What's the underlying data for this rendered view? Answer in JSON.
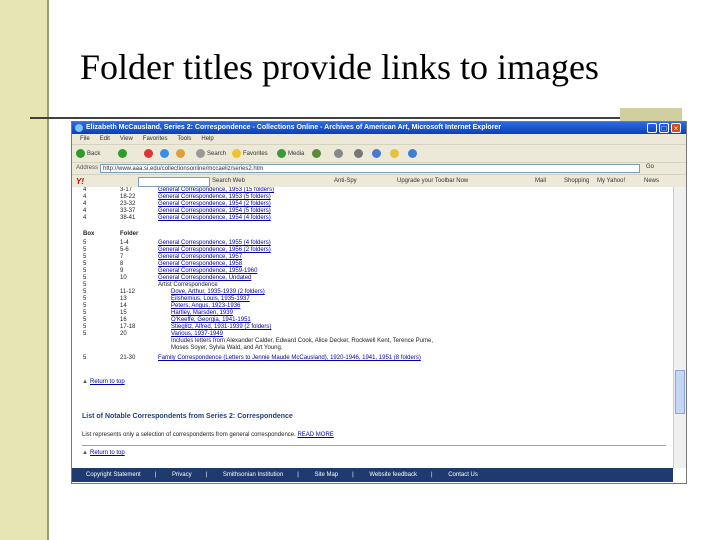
{
  "slide": {
    "title": "Folder titles provide links to images"
  },
  "browser": {
    "window_title": "Elizabeth McCausland, Series 2: Correspondence - Collections Online - Archives of American Art, Microsoft Internet Explorer",
    "menu": [
      "File",
      "Edit",
      "View",
      "Favorites",
      "Tools",
      "Help"
    ],
    "toolbar": {
      "back": "Back",
      "search": "Search",
      "favorites": "Favorites",
      "media": "Media"
    },
    "address_label": "Address",
    "address_value": "http://www.aaa.si.edu/collectionsonline/mccaeliz/series2.htm",
    "go_label": "Go",
    "yahoo": {
      "logo": "Y!",
      "search_web": "Search Web",
      "anti_spy": "Anti-Spy",
      "upgrade": "Upgrade your Toolbar Now",
      "mail": "Mail",
      "shopping": "Shopping",
      "my_yahoo": "My Yahoo!",
      "news": "News"
    }
  },
  "content": {
    "rows_top": [
      {
        "box": "4",
        "folder": "3-17",
        "title": "General Correspondence, 1953 (15 folders)"
      },
      {
        "box": "4",
        "folder": "18-22",
        "title": "General Correspondence, 1953 (5 folders)"
      },
      {
        "box": "4",
        "folder": "23-32",
        "title": "General Correspondence, 1954 (2 folders)"
      },
      {
        "box": "4",
        "folder": "33-37",
        "title": "General Correspondence, 1954 (5 folders)"
      },
      {
        "box": "4",
        "folder": "38-41",
        "title": "General Correspondence, 1954 (4 folders)"
      }
    ],
    "header": {
      "box": "Box",
      "folder": "Folder"
    },
    "rows_bottom": [
      {
        "box": "5",
        "folder": "1-4",
        "title": "General Correspondence, 1955 (4 folders)",
        "style": "link"
      },
      {
        "box": "5",
        "folder": "5-6",
        "title": "General Correspondence, 1956 (2 folders)",
        "style": "link"
      },
      {
        "box": "5",
        "folder": "7",
        "title": "General Correspondence, 1957",
        "style": "link"
      },
      {
        "box": "5",
        "folder": "8",
        "title": "General Correspondence, 1958",
        "style": "link"
      },
      {
        "box": "5",
        "folder": "9",
        "title": "General Correspondence, 1959-1960",
        "style": "link"
      },
      {
        "box": "5",
        "folder": "10",
        "title": "General Correspondence, Undated",
        "style": "link"
      },
      {
        "box": "5",
        "folder": "",
        "title": "Artist Correspondence",
        "style": "plain"
      },
      {
        "box": "5",
        "folder": "11-12",
        "title": "Dove, Arthur, 1935-1939 (2 folders)",
        "style": "sub"
      },
      {
        "box": "5",
        "folder": "13",
        "title": "Eilshemius, Louis, 1935-1937",
        "style": "sub"
      },
      {
        "box": "5",
        "folder": "14",
        "title": "Peters, Angus, 1923-1936",
        "style": "sub"
      },
      {
        "box": "5",
        "folder": "15",
        "title": "Hartley, Marsden, 1939",
        "style": "sub"
      },
      {
        "box": "5",
        "folder": "16",
        "title": "O'Keeffe, Georgia, 1941-1951",
        "style": "sub"
      },
      {
        "box": "5",
        "folder": "17-18",
        "title": "Stieglitz, Alfred, 1931-1939 (2 folders)",
        "style": "sub"
      },
      {
        "box": "5",
        "folder": "20",
        "title": "Various, 1937-1949",
        "style": "sub"
      }
    ],
    "note_line1": "Includes letters from Alexander Calder, Edward Cook, Alice Decker, Rockwell Kent, Terence Pume,",
    "note_line2": "Moses Soyer, Sylvia Wald, and Art Young.",
    "last_row": {
      "box": "5",
      "folder": "21-30",
      "title": "Family Correspondence (Letters to Jennie Maude McCausland), 1920-1946, 1941, 1951 (8 folders)"
    },
    "return_label": "Return to top",
    "section_title": "List of Notable Correspondents from Series 2: Correspondence",
    "section_text": "List represents only a selection of correspondents from general correspondence.",
    "read_more": "READ MORE",
    "return_label2": "Return to top"
  },
  "footer": [
    "Copyright Statement",
    "Privacy",
    "Smithsonian Institution",
    "Site Map",
    "Website feedback",
    "Contact Us"
  ]
}
